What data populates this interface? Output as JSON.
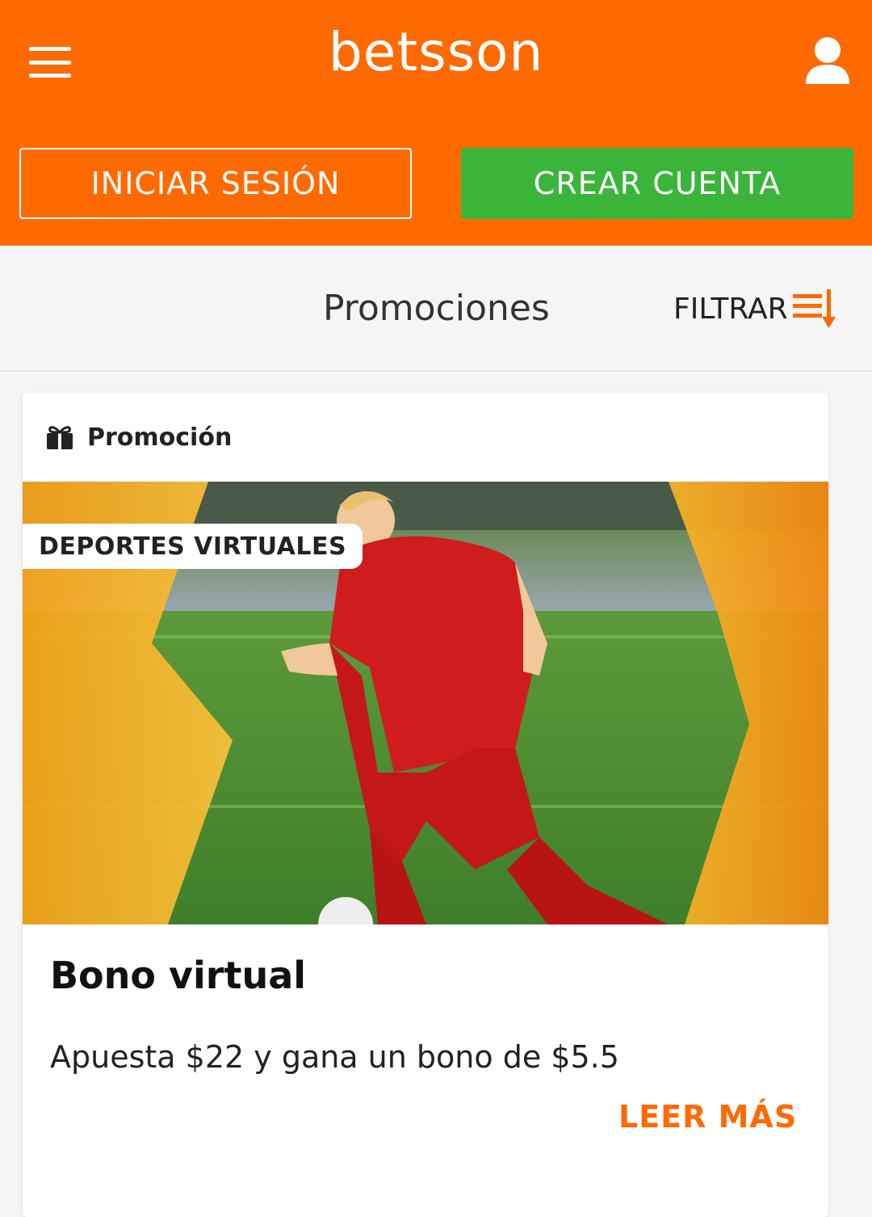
{
  "header": {
    "logo_text": "betsson",
    "menu_icon": "hamburger-menu-icon",
    "user_icon": "user-icon",
    "login_label": "INICIAR SESIÓN",
    "register_label": "CREAR CUENTA",
    "brand_color": "#ff6a00",
    "register_color": "#3ab53a"
  },
  "subbar": {
    "title": "Promociones",
    "filter_label": "FILTRAR",
    "filter_icon": "filter-sort-icon"
  },
  "promo_card": {
    "type_icon": "gift-icon",
    "type_label": "Promoción",
    "tag": "DEPORTES VIRTUALES",
    "image_alt": "virtual soccer player",
    "title": "Bono virtual",
    "description": "Apuesta $22 y gana un bono de $5.5",
    "cta": "LEER MÁS"
  }
}
